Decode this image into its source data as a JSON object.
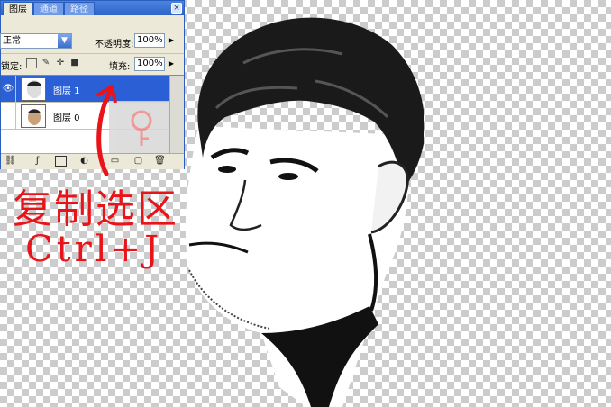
{
  "panel": {
    "tabs": [
      "图层",
      "通道",
      "路径"
    ],
    "active_tab": 0,
    "close_glyph": "×",
    "blend_mode": "正常",
    "opacity_label": "不透明度:",
    "opacity_value": "100%",
    "lock_label": "锁定:",
    "fill_label": "填充:",
    "fill_value": "100%",
    "layers": [
      {
        "name": "图层 1",
        "selected": true,
        "visible": true
      },
      {
        "name": "图层 0",
        "selected": false,
        "visible": false
      }
    ]
  },
  "annotation": {
    "line1": "复制选区",
    "line2": "Ctrl+J",
    "color": "#e8141a"
  },
  "icons": [
    "close-icon",
    "dropdown-arrow-icon",
    "lock-transparent-icon",
    "lock-brush-icon",
    "lock-move-icon",
    "lock-all-icon",
    "eye-icon",
    "link-icon",
    "layer-style-icon",
    "mask-icon",
    "adjustment-icon",
    "folder-icon",
    "new-layer-icon",
    "trash-icon"
  ]
}
